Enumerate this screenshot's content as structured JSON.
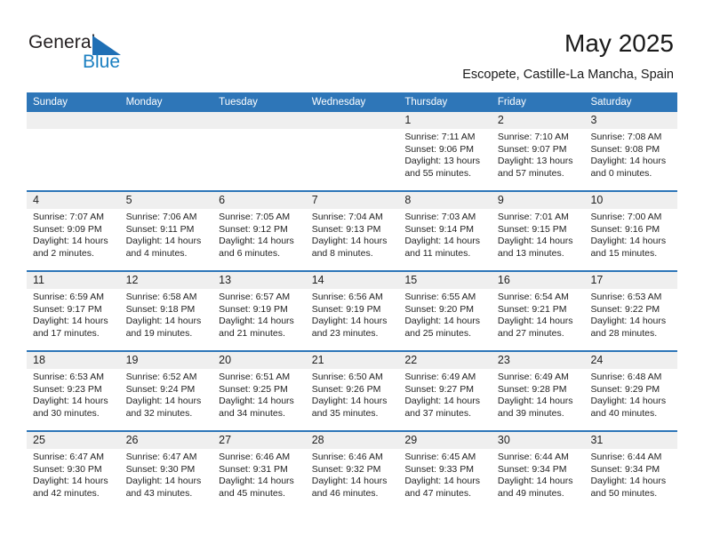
{
  "brand": {
    "word_general": "General",
    "word_blue": "Blue",
    "flag_icon": "triangle-flag-icon",
    "accent_color": "#1a7fc1"
  },
  "header": {
    "title": "May 2025",
    "location": "Escopete, Castille-La Mancha, Spain"
  },
  "theme": {
    "header_blue": "#2e76b8",
    "daynum_strip": "#efefef",
    "text": "#1f1f1f"
  },
  "weekdays": [
    "Sunday",
    "Monday",
    "Tuesday",
    "Wednesday",
    "Thursday",
    "Friday",
    "Saturday"
  ],
  "weeks": [
    [
      {
        "day": "",
        "sunrise": "",
        "sunset": "",
        "daylight_l1": "",
        "daylight_l2": ""
      },
      {
        "day": "",
        "sunrise": "",
        "sunset": "",
        "daylight_l1": "",
        "daylight_l2": ""
      },
      {
        "day": "",
        "sunrise": "",
        "sunset": "",
        "daylight_l1": "",
        "daylight_l2": ""
      },
      {
        "day": "",
        "sunrise": "",
        "sunset": "",
        "daylight_l1": "",
        "daylight_l2": ""
      },
      {
        "day": "1",
        "sunrise": "Sunrise: 7:11 AM",
        "sunset": "Sunset: 9:06 PM",
        "daylight_l1": "Daylight: 13 hours",
        "daylight_l2": "and 55 minutes."
      },
      {
        "day": "2",
        "sunrise": "Sunrise: 7:10 AM",
        "sunset": "Sunset: 9:07 PM",
        "daylight_l1": "Daylight: 13 hours",
        "daylight_l2": "and 57 minutes."
      },
      {
        "day": "3",
        "sunrise": "Sunrise: 7:08 AM",
        "sunset": "Sunset: 9:08 PM",
        "daylight_l1": "Daylight: 14 hours",
        "daylight_l2": "and 0 minutes."
      }
    ],
    [
      {
        "day": "4",
        "sunrise": "Sunrise: 7:07 AM",
        "sunset": "Sunset: 9:09 PM",
        "daylight_l1": "Daylight: 14 hours",
        "daylight_l2": "and 2 minutes."
      },
      {
        "day": "5",
        "sunrise": "Sunrise: 7:06 AM",
        "sunset": "Sunset: 9:11 PM",
        "daylight_l1": "Daylight: 14 hours",
        "daylight_l2": "and 4 minutes."
      },
      {
        "day": "6",
        "sunrise": "Sunrise: 7:05 AM",
        "sunset": "Sunset: 9:12 PM",
        "daylight_l1": "Daylight: 14 hours",
        "daylight_l2": "and 6 minutes."
      },
      {
        "day": "7",
        "sunrise": "Sunrise: 7:04 AM",
        "sunset": "Sunset: 9:13 PM",
        "daylight_l1": "Daylight: 14 hours",
        "daylight_l2": "and 8 minutes."
      },
      {
        "day": "8",
        "sunrise": "Sunrise: 7:03 AM",
        "sunset": "Sunset: 9:14 PM",
        "daylight_l1": "Daylight: 14 hours",
        "daylight_l2": "and 11 minutes."
      },
      {
        "day": "9",
        "sunrise": "Sunrise: 7:01 AM",
        "sunset": "Sunset: 9:15 PM",
        "daylight_l1": "Daylight: 14 hours",
        "daylight_l2": "and 13 minutes."
      },
      {
        "day": "10",
        "sunrise": "Sunrise: 7:00 AM",
        "sunset": "Sunset: 9:16 PM",
        "daylight_l1": "Daylight: 14 hours",
        "daylight_l2": "and 15 minutes."
      }
    ],
    [
      {
        "day": "11",
        "sunrise": "Sunrise: 6:59 AM",
        "sunset": "Sunset: 9:17 PM",
        "daylight_l1": "Daylight: 14 hours",
        "daylight_l2": "and 17 minutes."
      },
      {
        "day": "12",
        "sunrise": "Sunrise: 6:58 AM",
        "sunset": "Sunset: 9:18 PM",
        "daylight_l1": "Daylight: 14 hours",
        "daylight_l2": "and 19 minutes."
      },
      {
        "day": "13",
        "sunrise": "Sunrise: 6:57 AM",
        "sunset": "Sunset: 9:19 PM",
        "daylight_l1": "Daylight: 14 hours",
        "daylight_l2": "and 21 minutes."
      },
      {
        "day": "14",
        "sunrise": "Sunrise: 6:56 AM",
        "sunset": "Sunset: 9:19 PM",
        "daylight_l1": "Daylight: 14 hours",
        "daylight_l2": "and 23 minutes."
      },
      {
        "day": "15",
        "sunrise": "Sunrise: 6:55 AM",
        "sunset": "Sunset: 9:20 PM",
        "daylight_l1": "Daylight: 14 hours",
        "daylight_l2": "and 25 minutes."
      },
      {
        "day": "16",
        "sunrise": "Sunrise: 6:54 AM",
        "sunset": "Sunset: 9:21 PM",
        "daylight_l1": "Daylight: 14 hours",
        "daylight_l2": "and 27 minutes."
      },
      {
        "day": "17",
        "sunrise": "Sunrise: 6:53 AM",
        "sunset": "Sunset: 9:22 PM",
        "daylight_l1": "Daylight: 14 hours",
        "daylight_l2": "and 28 minutes."
      }
    ],
    [
      {
        "day": "18",
        "sunrise": "Sunrise: 6:53 AM",
        "sunset": "Sunset: 9:23 PM",
        "daylight_l1": "Daylight: 14 hours",
        "daylight_l2": "and 30 minutes."
      },
      {
        "day": "19",
        "sunrise": "Sunrise: 6:52 AM",
        "sunset": "Sunset: 9:24 PM",
        "daylight_l1": "Daylight: 14 hours",
        "daylight_l2": "and 32 minutes."
      },
      {
        "day": "20",
        "sunrise": "Sunrise: 6:51 AM",
        "sunset": "Sunset: 9:25 PM",
        "daylight_l1": "Daylight: 14 hours",
        "daylight_l2": "and 34 minutes."
      },
      {
        "day": "21",
        "sunrise": "Sunrise: 6:50 AM",
        "sunset": "Sunset: 9:26 PM",
        "daylight_l1": "Daylight: 14 hours",
        "daylight_l2": "and 35 minutes."
      },
      {
        "day": "22",
        "sunrise": "Sunrise: 6:49 AM",
        "sunset": "Sunset: 9:27 PM",
        "daylight_l1": "Daylight: 14 hours",
        "daylight_l2": "and 37 minutes."
      },
      {
        "day": "23",
        "sunrise": "Sunrise: 6:49 AM",
        "sunset": "Sunset: 9:28 PM",
        "daylight_l1": "Daylight: 14 hours",
        "daylight_l2": "and 39 minutes."
      },
      {
        "day": "24",
        "sunrise": "Sunrise: 6:48 AM",
        "sunset": "Sunset: 9:29 PM",
        "daylight_l1": "Daylight: 14 hours",
        "daylight_l2": "and 40 minutes."
      }
    ],
    [
      {
        "day": "25",
        "sunrise": "Sunrise: 6:47 AM",
        "sunset": "Sunset: 9:30 PM",
        "daylight_l1": "Daylight: 14 hours",
        "daylight_l2": "and 42 minutes."
      },
      {
        "day": "26",
        "sunrise": "Sunrise: 6:47 AM",
        "sunset": "Sunset: 9:30 PM",
        "daylight_l1": "Daylight: 14 hours",
        "daylight_l2": "and 43 minutes."
      },
      {
        "day": "27",
        "sunrise": "Sunrise: 6:46 AM",
        "sunset": "Sunset: 9:31 PM",
        "daylight_l1": "Daylight: 14 hours",
        "daylight_l2": "and 45 minutes."
      },
      {
        "day": "28",
        "sunrise": "Sunrise: 6:46 AM",
        "sunset": "Sunset: 9:32 PM",
        "daylight_l1": "Daylight: 14 hours",
        "daylight_l2": "and 46 minutes."
      },
      {
        "day": "29",
        "sunrise": "Sunrise: 6:45 AM",
        "sunset": "Sunset: 9:33 PM",
        "daylight_l1": "Daylight: 14 hours",
        "daylight_l2": "and 47 minutes."
      },
      {
        "day": "30",
        "sunrise": "Sunrise: 6:44 AM",
        "sunset": "Sunset: 9:34 PM",
        "daylight_l1": "Daylight: 14 hours",
        "daylight_l2": "and 49 minutes."
      },
      {
        "day": "31",
        "sunrise": "Sunrise: 6:44 AM",
        "sunset": "Sunset: 9:34 PM",
        "daylight_l1": "Daylight: 14 hours",
        "daylight_l2": "and 50 minutes."
      }
    ]
  ]
}
